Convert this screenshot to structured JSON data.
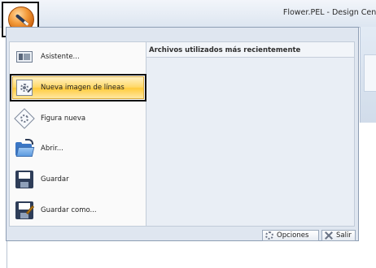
{
  "window": {
    "title": "Flower.PEL - Design Cent"
  },
  "app_button": {
    "icon": "app-orb-pen-icon"
  },
  "menu": {
    "items": [
      {
        "label": "Asistente...",
        "icon": "wizard-icon"
      },
      {
        "label": "Nueva imagen de líneas",
        "icon": "line-image-icon",
        "highlighted": true
      },
      {
        "label": "Figura nueva",
        "icon": "new-shape-icon"
      },
      {
        "label": "Abrir...",
        "icon": "open-folder-icon"
      },
      {
        "label": "Guardar",
        "icon": "save-icon"
      },
      {
        "label": "Guardar como...",
        "icon": "save-as-icon"
      }
    ],
    "recent_files_heading": "Archivos utilizados más recientemente",
    "options_button": "Opciones",
    "exit_button": "Salir"
  },
  "colors": {
    "highlight": "#ffd867",
    "menu_background": "#dfe6f0",
    "title_bar": "#dde6f1"
  }
}
